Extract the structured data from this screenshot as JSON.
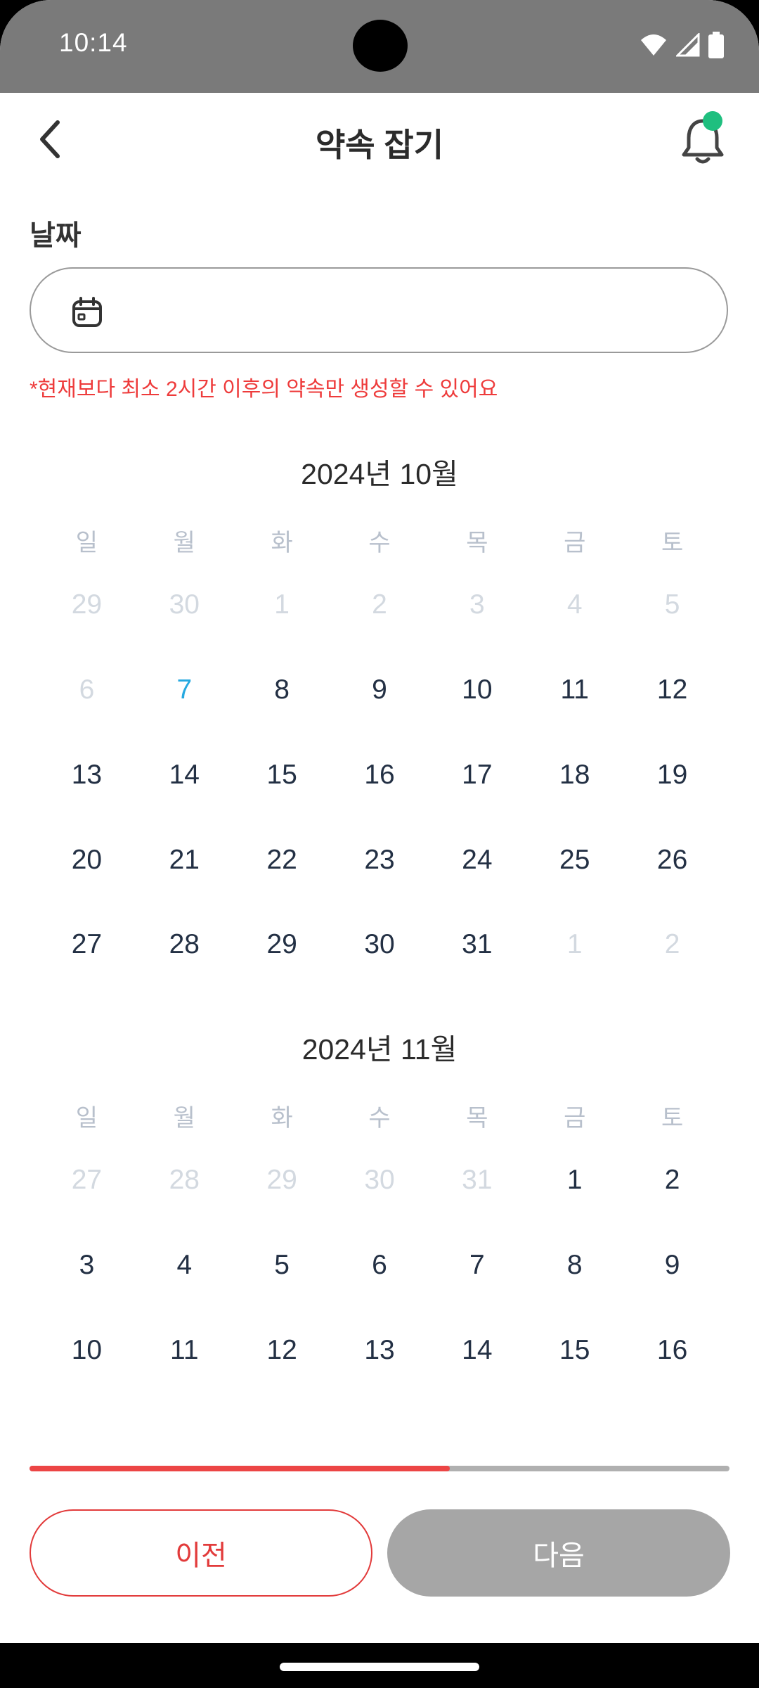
{
  "status_bar": {
    "time": "10:14"
  },
  "header": {
    "title": "약속 잡기"
  },
  "form": {
    "date_label": "날짜",
    "date_value": "",
    "notice": "*현재보다 최소 2시간 이후의 약속만 생성할 수 있어요"
  },
  "weekdays": [
    "일",
    "월",
    "화",
    "수",
    "목",
    "금",
    "토"
  ],
  "months": [
    {
      "title": "2024년 10월",
      "weeks": [
        [
          {
            "d": "29",
            "dim": true
          },
          {
            "d": "30",
            "dim": true
          },
          {
            "d": "1",
            "dim": true
          },
          {
            "d": "2",
            "dim": true
          },
          {
            "d": "3",
            "dim": true
          },
          {
            "d": "4",
            "dim": true
          },
          {
            "d": "5",
            "dim": true
          }
        ],
        [
          {
            "d": "6",
            "dim": true
          },
          {
            "d": "7",
            "today": true
          },
          {
            "d": "8"
          },
          {
            "d": "9"
          },
          {
            "d": "10"
          },
          {
            "d": "11"
          },
          {
            "d": "12"
          }
        ],
        [
          {
            "d": "13"
          },
          {
            "d": "14"
          },
          {
            "d": "15"
          },
          {
            "d": "16"
          },
          {
            "d": "17"
          },
          {
            "d": "18"
          },
          {
            "d": "19"
          }
        ],
        [
          {
            "d": "20"
          },
          {
            "d": "21"
          },
          {
            "d": "22"
          },
          {
            "d": "23"
          },
          {
            "d": "24"
          },
          {
            "d": "25"
          },
          {
            "d": "26"
          }
        ],
        [
          {
            "d": "27"
          },
          {
            "d": "28"
          },
          {
            "d": "29"
          },
          {
            "d": "30"
          },
          {
            "d": "31"
          },
          {
            "d": "1",
            "dim": true
          },
          {
            "d": "2",
            "dim": true
          }
        ]
      ]
    },
    {
      "title": "2024년 11월",
      "weeks": [
        [
          {
            "d": "27",
            "dim": true
          },
          {
            "d": "28",
            "dim": true
          },
          {
            "d": "29",
            "dim": true
          },
          {
            "d": "30",
            "dim": true
          },
          {
            "d": "31",
            "dim": true
          },
          {
            "d": "1"
          },
          {
            "d": "2"
          }
        ],
        [
          {
            "d": "3"
          },
          {
            "d": "4"
          },
          {
            "d": "5"
          },
          {
            "d": "6"
          },
          {
            "d": "7"
          },
          {
            "d": "8"
          },
          {
            "d": "9"
          }
        ],
        [
          {
            "d": "10"
          },
          {
            "d": "11"
          },
          {
            "d": "12"
          },
          {
            "d": "13"
          },
          {
            "d": "14"
          },
          {
            "d": "15"
          },
          {
            "d": "16"
          }
        ]
      ]
    }
  ],
  "progress": {
    "fraction": 0.6
  },
  "buttons": {
    "prev_label": "이전",
    "next_label": "다음"
  },
  "colors": {
    "accent": "#ec4545",
    "today": "#26a9e0",
    "notification_dot": "#1fbf7f",
    "disabled_button": "#a6a6a6"
  },
  "icons": [
    "back-chevron-icon",
    "bell-icon",
    "calendar-icon",
    "wifi-icon",
    "signal-icon",
    "battery-icon"
  ]
}
